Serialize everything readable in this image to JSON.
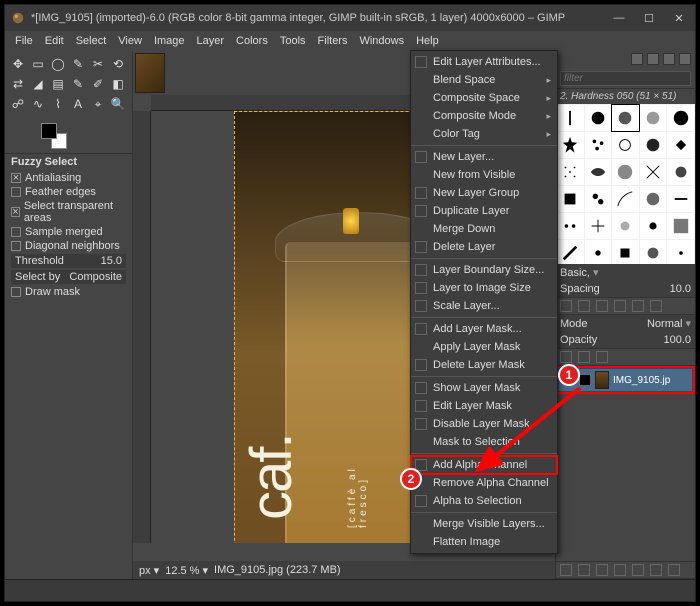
{
  "title": "*[IMG_9105] (imported)-6.0 (RGB color 8-bit gamma integer, GIMP built-in sRGB, 1 layer) 4000x6000 – GIMP",
  "menubar": [
    "File",
    "Edit",
    "Select",
    "View",
    "Image",
    "Layer",
    "Colors",
    "Tools",
    "Filters",
    "Windows",
    "Help"
  ],
  "tool_options": {
    "title": "Fuzzy Select",
    "rows": [
      {
        "c": true,
        "l": "Antialiasing"
      },
      {
        "c": false,
        "l": "Feather edges"
      },
      {
        "c": true,
        "l": "Select transparent areas"
      },
      {
        "c": false,
        "l": "Sample merged"
      },
      {
        "c": false,
        "l": "Diagonal neighbors"
      }
    ],
    "threshold_label": "Threshold",
    "threshold_value": "15.0",
    "selectby_label": "Select by",
    "selectby_value": "Composite",
    "drawmask": {
      "c": false,
      "l": "Draw mask"
    }
  },
  "status": {
    "unit": "px",
    "zoom": "12.5 %",
    "file": "IMG_9105.jpg (223.7 MB)"
  },
  "brushes": {
    "filter_ph": "filter",
    "label": "2. Hardness 050 (51 × 51)",
    "preset": "Basic,",
    "spacing_label": "Spacing",
    "spacing_value": "10.0"
  },
  "layers": {
    "mode_label": "Mode",
    "mode_value": "Normal",
    "opacity_label": "Opacity",
    "opacity_value": "100.0",
    "layer_name": "IMG_9105.jp"
  },
  "ctx": {
    "edit_attrs": "Edit Layer Attributes...",
    "blend": "Blend Space",
    "comp_space": "Composite Space",
    "comp_mode": "Composite Mode",
    "color_tag": "Color Tag",
    "new_layer": "New Layer...",
    "new_visible": "New from Visible",
    "new_group": "New Layer Group",
    "dup": "Duplicate Layer",
    "merge_down": "Merge Down",
    "delete": "Delete Layer",
    "boundary": "Layer Boundary Size...",
    "to_img": "Layer to Image Size",
    "scale": "Scale Layer...",
    "add_mask": "Add Layer Mask...",
    "apply_mask": "Apply Layer Mask",
    "del_mask": "Delete Layer Mask",
    "show_mask": "Show Layer Mask",
    "edit_mask": "Edit Layer Mask",
    "disable_mask": "Disable Layer Mask",
    "mask_sel": "Mask to Selection",
    "add_alpha": "Add Alpha Channel",
    "rem_alpha": "Remove Alpha Channel",
    "alpha_sel": "Alpha to Selection",
    "merge_vis": "Merge Visible Layers...",
    "flatten": "Flatten Image"
  },
  "callouts": {
    "one": "1",
    "two": "2"
  },
  "cup": {
    "brand": "caf.",
    "sub": "[caffè al fresco]"
  }
}
